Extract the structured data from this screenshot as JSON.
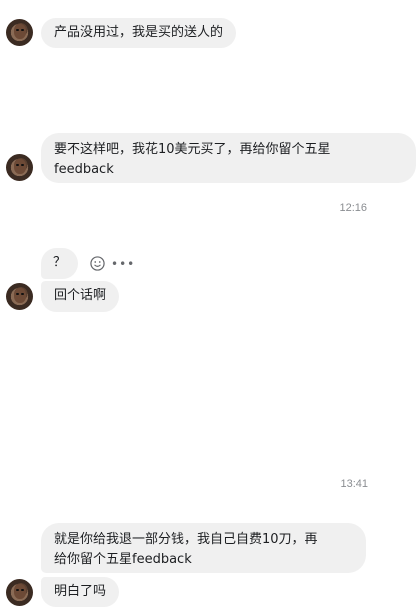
{
  "messages": {
    "m1": "产品没用过，我是买的送人的",
    "m2_line1": "要不这样吧，我花10美元买了，再给你留个五星",
    "m2_line2": "feedback",
    "m3": "？",
    "m4": "回个话啊",
    "m5_line1": "就是你给我退一部分钱，我自己自费10刀，再",
    "m5_line2": "给你留个五星feedback",
    "m6": "明白了吗"
  },
  "timestamps": {
    "t1": "12:16",
    "t2": "13:41"
  },
  "icons": {
    "react": "smile-icon",
    "more": "more-icon"
  }
}
